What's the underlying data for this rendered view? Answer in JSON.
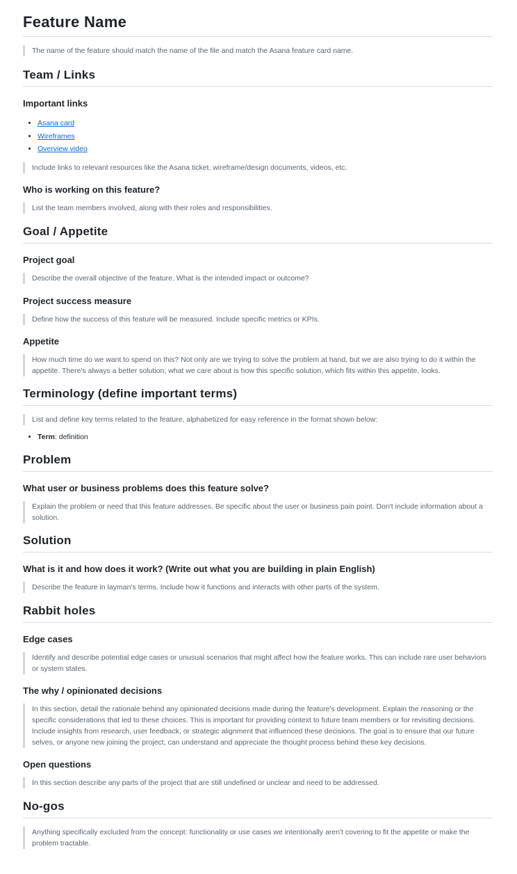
{
  "title": "Feature Name",
  "title_note": "The name of the feature should match the name of the file and match the Asana feature card name.",
  "team_links": {
    "heading": "Team / Links",
    "important_links": {
      "heading": "Important links",
      "links": [
        "Asana card",
        "Wireframes",
        "Overview video"
      ],
      "note": "Include links to relevant resources like the Asana ticket, wireframe/design documents, videos, etc."
    },
    "who": {
      "heading": "Who is working on this feature?",
      "note": "List the team members involved, along with their roles and responsibilities."
    }
  },
  "goal": {
    "heading": "Goal / Appetite",
    "project_goal": {
      "heading": "Project goal",
      "note": "Describe the overall objective of the feature. What is the intended impact or outcome?"
    },
    "success": {
      "heading": "Project success measure",
      "note": "Define how the success of this feature will be measured. Include specific metrics or KPIs."
    },
    "appetite": {
      "heading": "Appetite",
      "note": "How much time do we want to spend on this? Not only are we trying to solve the problem at hand, but we are also trying to do it within the appetite. There's always a better solution; what we care about is how this specific solution, which fits within this appetite, looks."
    }
  },
  "terminology": {
    "heading": "Terminology (define important terms)",
    "note": "List and define key terms related to the feature, alphabetized for easy reference in the format shown below:",
    "term": "Term",
    "definition": ": definition"
  },
  "problem": {
    "heading": "Problem",
    "sub": {
      "heading": "What user or business problems does this feature solve?",
      "note": "Explain the problem or need that this feature addresses. Be specific about the user or business pain point. Don't include information about a solution."
    }
  },
  "solution": {
    "heading": "Solution",
    "sub": {
      "heading": "What is it and how does it work? (Write out what you are building in plain English)",
      "note": "Describe the feature in layman's terms. Include how it functions and interacts with other parts of the system."
    }
  },
  "rabbit_holes": {
    "heading": "Rabbit holes",
    "edge_cases": {
      "heading": "Edge cases",
      "note": "Identify and describe potential edge cases or unusual scenarios that might affect how the feature works. This can include rare user behaviors or system states."
    },
    "why": {
      "heading": "The why / opinionated decisions",
      "note": "In this section, detail the rationale behind any opinionated decisions made during the feature's development. Explain the reasoning or the specific considerations that led to these choices. This is important for providing context to future team members or for revisiting decisions. Include insights from research, user feedback, or strategic alignment that influenced these decisions. The goal is to ensure that our future selves, or anyone new joining the project, can understand and appreciate the thought process behind these key decisions."
    },
    "open_questions": {
      "heading": "Open questions",
      "note": "In this section describe any parts of the project that are still undefined or unclear and need to be addressed."
    }
  },
  "no_gos": {
    "heading": "No-gos",
    "note": "Anything specifically excluded from the concept: functionality or use cases we intentionally aren't covering to fit the appetite or make the problem tractable."
  }
}
